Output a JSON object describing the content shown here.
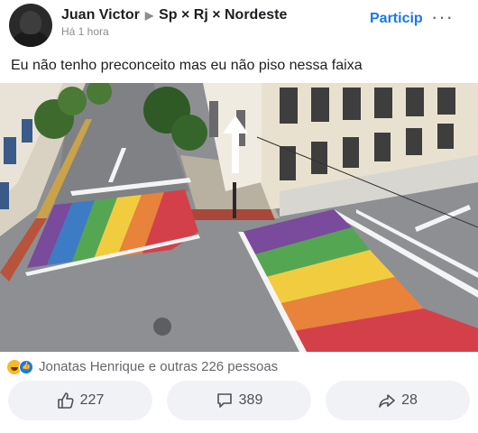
{
  "post": {
    "author": "Juan Victor",
    "group": "Sp × Rj × Nordeste",
    "time": "Há 1 hora",
    "join_label": "Particip",
    "more_label": "···",
    "text": "Eu não tenho preconceito mas eu não piso nessa faixa"
  },
  "reactions": {
    "summary": "Jonatas Henrique e outras 226 pessoas",
    "icons": [
      "haha-icon",
      "like-icon"
    ]
  },
  "actions": {
    "like_count": "227",
    "comment_count": "389",
    "share_count": "28"
  },
  "photo": {
    "subject": "street intersection with rainbow crosswalks",
    "colors": {
      "red": "#d4404a",
      "orange": "#e9823a",
      "yellow": "#f2cc3f",
      "green": "#55a653",
      "blue": "#3d7bc5",
      "purple": "#7a4a9c",
      "asphalt": "#8f9194"
    }
  },
  "colors": {
    "link": "#1877f2",
    "text": "#1c1e21",
    "muted": "#65676b",
    "button_bg": "#f0f2f5"
  }
}
